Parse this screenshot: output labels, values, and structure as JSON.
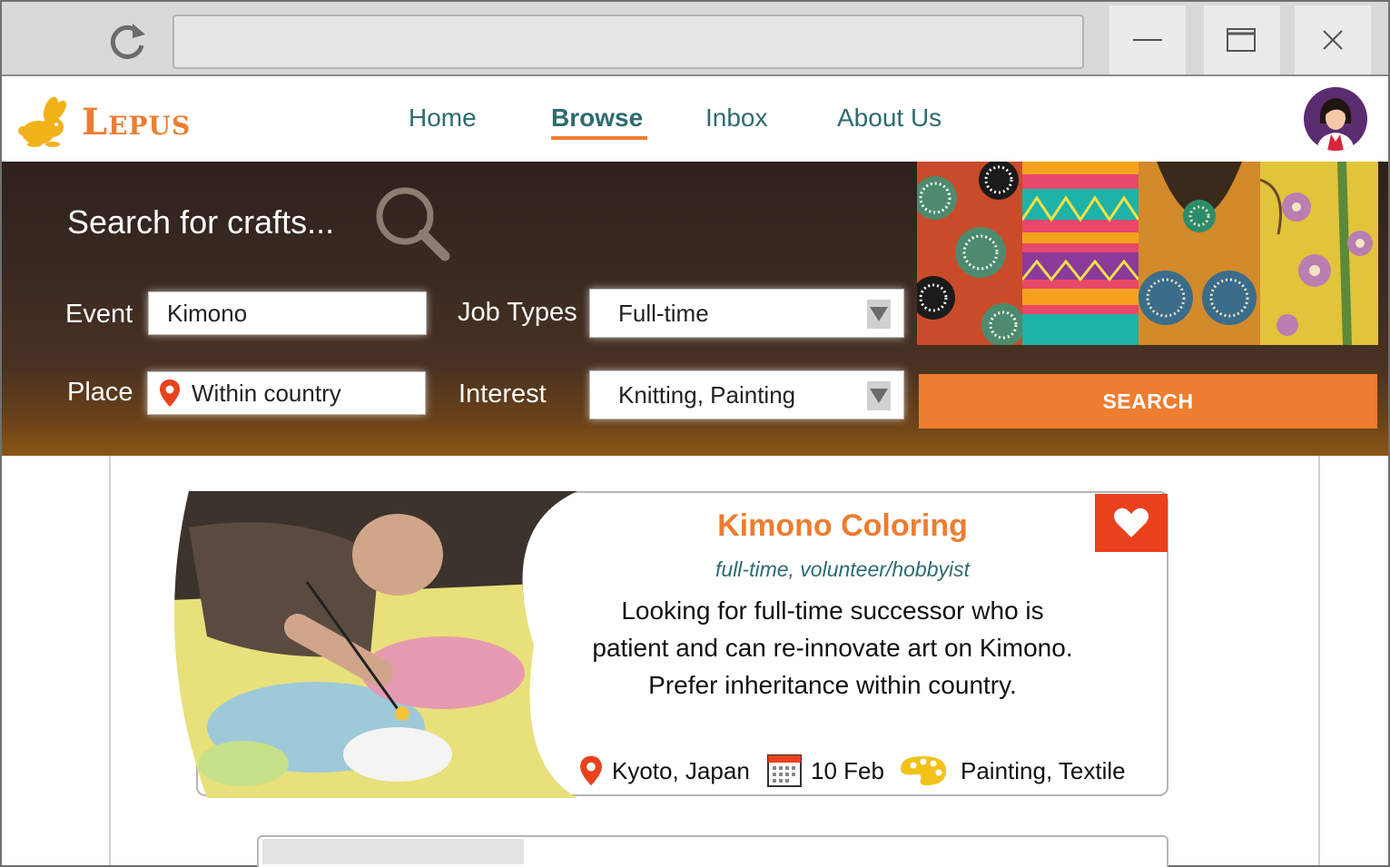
{
  "browser": {
    "url": "",
    "icons": {
      "reload": "reload-icon",
      "minimize": "minimize-icon",
      "maximize": "maximize-icon",
      "close": "close-icon"
    }
  },
  "header": {
    "logo_text": "Lepus",
    "nav": [
      {
        "label": "Home",
        "active": false
      },
      {
        "label": "Browse",
        "active": true
      },
      {
        "label": "Inbox",
        "active": false
      },
      {
        "label": "About Us",
        "active": false
      }
    ]
  },
  "search": {
    "title": "Search for crafts...",
    "event_label": "Event",
    "event_value": "Kimono",
    "place_label": "Place",
    "place_value": "Within country",
    "job_types_label": "Job Types",
    "job_types_value": "Full-time",
    "interest_label": "Interest",
    "interest_value": "Knitting, Painting",
    "button_label": "SEARCH"
  },
  "listing": {
    "title": "Kimono Coloring",
    "subtitle": "full-time, volunteer/hobbyist",
    "description_lines": [
      "Looking for full-time successor who is",
      "patient and can re-innovate art on Kimono.",
      "Prefer inheritance within country."
    ],
    "location": "Kyoto, Japan",
    "date": "10 Feb",
    "categories": "Painting, Textile"
  },
  "colors": {
    "accent": "#ed7d31",
    "nav_text": "#2e6b6f",
    "favorite": "#e8411c",
    "panel_dark": "#2e211d"
  }
}
